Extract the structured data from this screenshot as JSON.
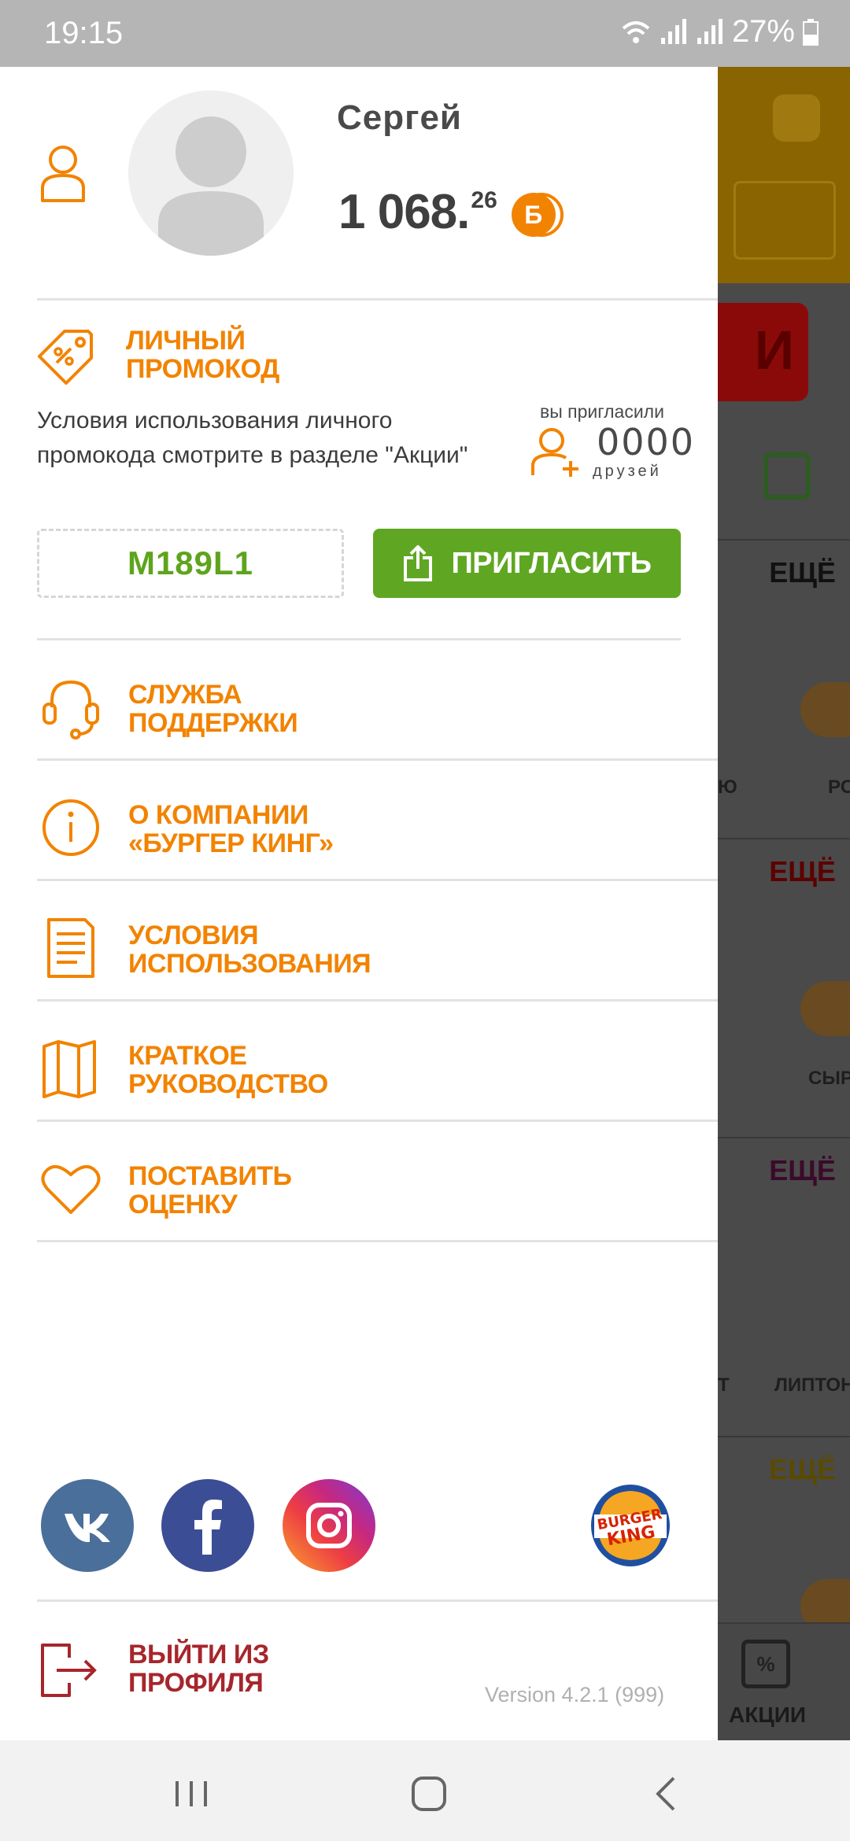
{
  "status_bar": {
    "time": "19:15",
    "battery": "27%"
  },
  "profile": {
    "name": "Сергей",
    "balance_int": "1 068.",
    "balance_frac": "26",
    "bonus_symbol": "Б"
  },
  "promo": {
    "title_line1": "ЛИЧНЫЙ",
    "title_line2": "ПРОМОКОД",
    "description": "Условия использования личного промокода смотрите в разделе \"Акции\"",
    "invited_label": "вы пригласили",
    "invited_count": "0000",
    "invited_unit": "друзей",
    "code": "M189L1",
    "invite_button": "ПРИГЛАСИТЬ"
  },
  "menu": [
    {
      "line1": "СЛУЖБА",
      "line2": "ПОДДЕРЖКИ",
      "icon": "headset-icon"
    },
    {
      "line1": "О КОМПАНИИ",
      "line2": "«БУРГЕР КИНГ»",
      "icon": "info-icon"
    },
    {
      "line1": "УСЛОВИЯ",
      "line2": "ИСПОЛЬЗОВАНИЯ",
      "icon": "document-icon"
    },
    {
      "line1": "КРАТКОЕ",
      "line2": "РУКОВОДСТВО",
      "icon": "book-icon"
    },
    {
      "line1": "ПОСТАВИТЬ",
      "line2": "ОЦЕНКУ",
      "icon": "heart-icon"
    }
  ],
  "social": [
    "vk-icon",
    "facebook-icon",
    "instagram-icon"
  ],
  "brand": {
    "logo_line1": "BURGER",
    "logo_line2": "KING"
  },
  "logout": {
    "line1": "ВЫЙТИ ИЗ",
    "line2": "ПРОФИЛЯ"
  },
  "version": "Version 4.2.1 (999)",
  "background": {
    "more_label": "ЕЩЁ",
    "captions": [
      "Ю",
      "РО",
      "СЫР",
      "Т",
      "ЛИПТОН"
    ],
    "bottom_tab": "АКЦИИ"
  },
  "colors": {
    "accent": "#f28300",
    "green": "#5fa722",
    "logout": "#a6262c"
  }
}
